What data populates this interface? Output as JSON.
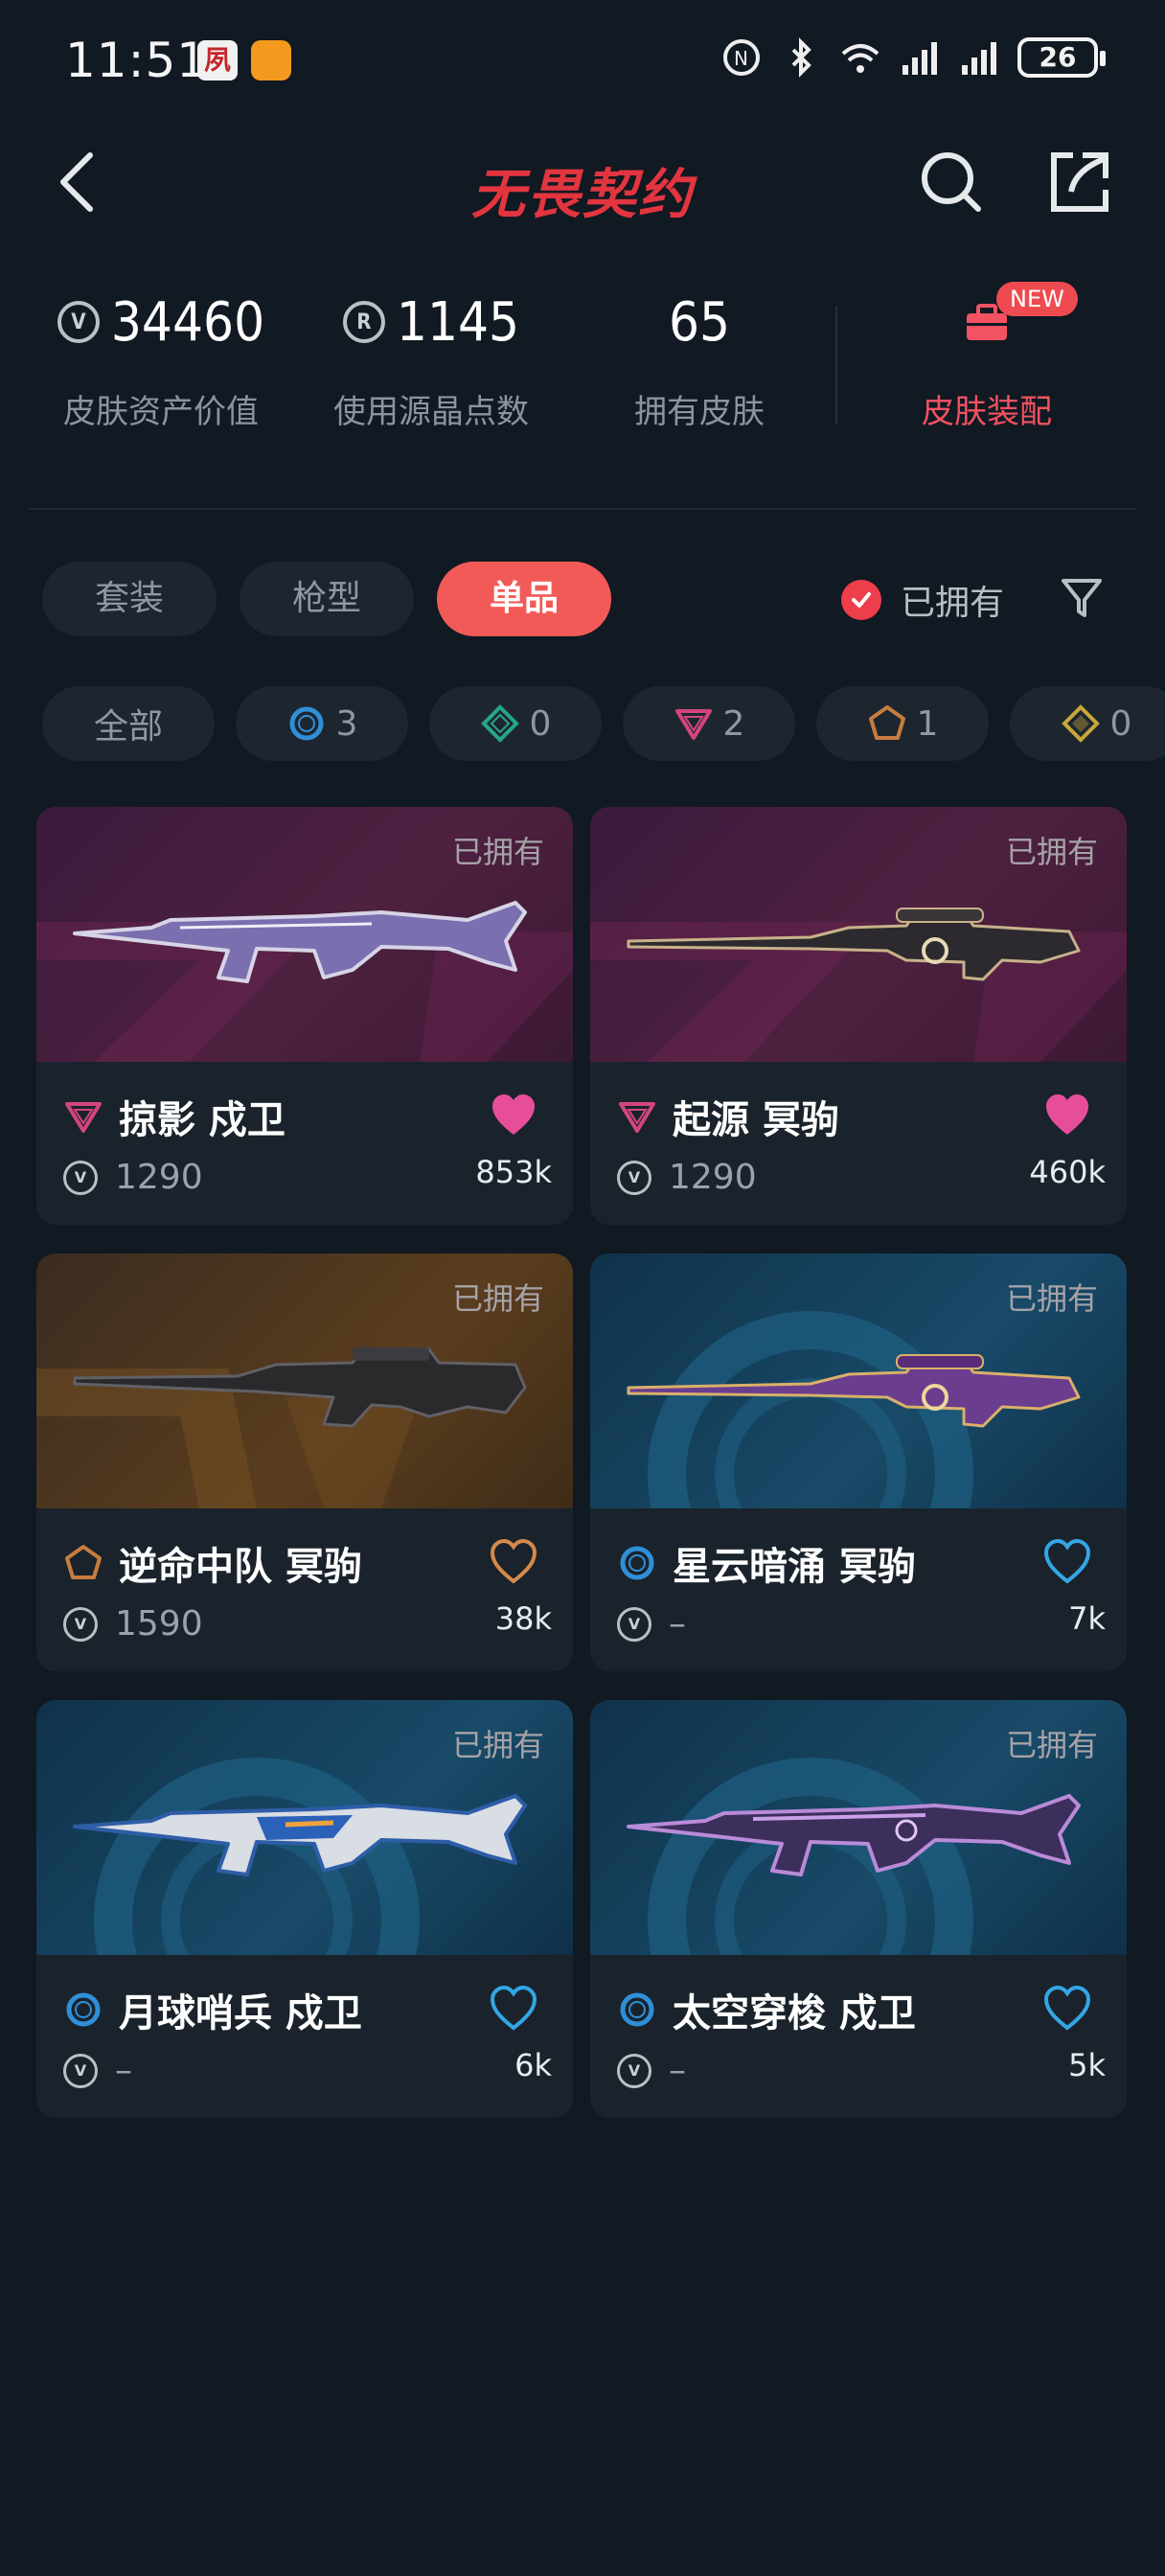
{
  "status_bar": {
    "time": "11:51",
    "app_icon_text": "夙",
    "battery": "26"
  },
  "header": {
    "title": "无畏契约"
  },
  "stats": {
    "asset_value": {
      "value": "34460",
      "label": "皮肤资产价值"
    },
    "radianite": {
      "value": "1145",
      "label": "使用源晶点数",
      "coin_letter": "R"
    },
    "owned_skins": {
      "value": "65",
      "label": "拥有皮肤"
    },
    "equip": {
      "label": "皮肤装配",
      "badge": "NEW"
    }
  },
  "tabs": [
    {
      "label": "套装"
    },
    {
      "label": "枪型"
    },
    {
      "label": "单品"
    }
  ],
  "owned_filter_label": "已拥有",
  "rarity_chips": [
    {
      "label": "全部"
    },
    {
      "count": "3",
      "color": "#2f8fd8"
    },
    {
      "count": "0",
      "color": "#26a58b"
    },
    {
      "count": "2",
      "color": "#d4457f"
    },
    {
      "count": "1",
      "color": "#c87c3e"
    },
    {
      "count": "0",
      "color": "#c9a83a"
    }
  ],
  "cards": [
    {
      "name": "掠影 戍卫",
      "price": "1290",
      "likes": "853k",
      "owned": "已拥有",
      "rarity": "premium",
      "theme": "purple",
      "heart_filled": true
    },
    {
      "name": "起源 冥驹",
      "price": "1290",
      "likes": "460k",
      "owned": "已拥有",
      "rarity": "premium",
      "theme": "purple",
      "heart_filled": true
    },
    {
      "name": "逆命中队 冥驹",
      "price": "1590",
      "likes": "38k",
      "owned": "已拥有",
      "rarity": "exclusive",
      "theme": "gold",
      "heart_filled": false
    },
    {
      "name": "星云暗涌 冥驹",
      "price": "–",
      "likes": "7k",
      "owned": "已拥有",
      "rarity": "select",
      "theme": "blue",
      "heart_filled": false
    },
    {
      "name": "月球哨兵 戍卫",
      "price": "–",
      "likes": "6k",
      "owned": "已拥有",
      "rarity": "select",
      "theme": "blue",
      "heart_filled": false
    },
    {
      "name": "太空穿梭 戍卫",
      "price": "–",
      "likes": "5k",
      "owned": "已拥有",
      "rarity": "select",
      "theme": "blue",
      "heart_filled": false
    }
  ]
}
